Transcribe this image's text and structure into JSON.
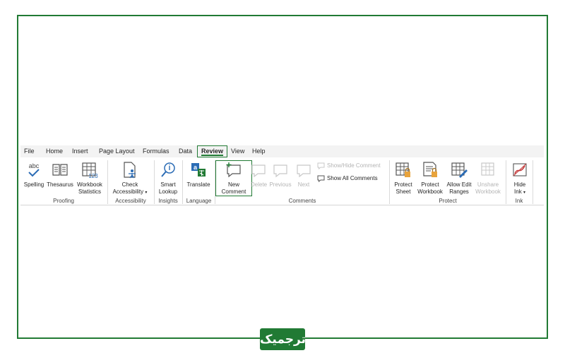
{
  "menu": {
    "file": "File",
    "home": "Home",
    "insert": "Insert",
    "page_layout": "Page Layout",
    "formulas": "Formulas",
    "data": "Data",
    "review": "Review",
    "view": "View",
    "help": "Help"
  },
  "proofing": {
    "spelling_icon_text": "abc",
    "spelling": "Spelling",
    "thesaurus": "Thesaurus",
    "workbook_l1": "Workbook",
    "workbook_l2": "Statistics",
    "workbook_icon_text": "123",
    "label": "Proofing"
  },
  "accessibility": {
    "check_l1": "Check",
    "check_l2": "Accessibility",
    "caret": "▾",
    "label": "Accessibility"
  },
  "insights": {
    "smart_l1": "Smart",
    "smart_l2": "Lookup",
    "label": "Insights"
  },
  "language": {
    "translate": "Translate",
    "label": "Language"
  },
  "comments": {
    "new_l1": "New",
    "new_l2": "Comment",
    "delete": "Delete",
    "previous": "Previous",
    "next": "Next",
    "show_hide": "Show/Hide Comment",
    "show_all": "Show All Comments",
    "label": "Comments"
  },
  "protect": {
    "sheet_l1": "Protect",
    "sheet_l2": "Sheet",
    "workbook_l1": "Protect",
    "workbook_l2": "Workbook",
    "allow_l1": "Allow Edit",
    "allow_l2": "Ranges",
    "unshare_l1": "Unshare",
    "unshare_l2": "Workbook",
    "label": "Protect"
  },
  "ink": {
    "hide_l1": "Hide",
    "hide_l2": "Ink",
    "caret": "▾",
    "label": "Ink"
  },
  "logo": {
    "text": "ترجمیک"
  },
  "colors": {
    "accent": "#217a34",
    "icon_blue": "#2b6cb5",
    "disabled": "#b4b4b4"
  }
}
